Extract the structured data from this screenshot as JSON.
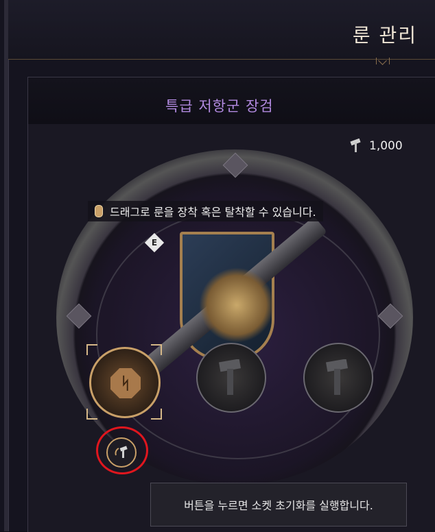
{
  "header": {
    "title": "룬 관리"
  },
  "item": {
    "name": "특급 저항군 장검"
  },
  "currency": {
    "icon": "hammer-icon",
    "amount": "1,000"
  },
  "hint": {
    "text": "드래그로 룬을 장착 혹은 탈착할 수 있습니다."
  },
  "e_key": {
    "label": "E"
  },
  "sockets": [
    {
      "state": "equipped",
      "icon": "rune-icon"
    },
    {
      "state": "empty",
      "icon": "hammer-icon"
    },
    {
      "state": "empty",
      "icon": "hammer-icon"
    }
  ],
  "reset": {
    "icon": "reset-hammer-icon"
  },
  "tooltip": {
    "text": "버튼을 누르면 소켓 초기화를 실행합니다."
  },
  "colors": {
    "accent": "#c9a068",
    "item_name": "#b28ae0",
    "highlight": "#e0161e"
  }
}
